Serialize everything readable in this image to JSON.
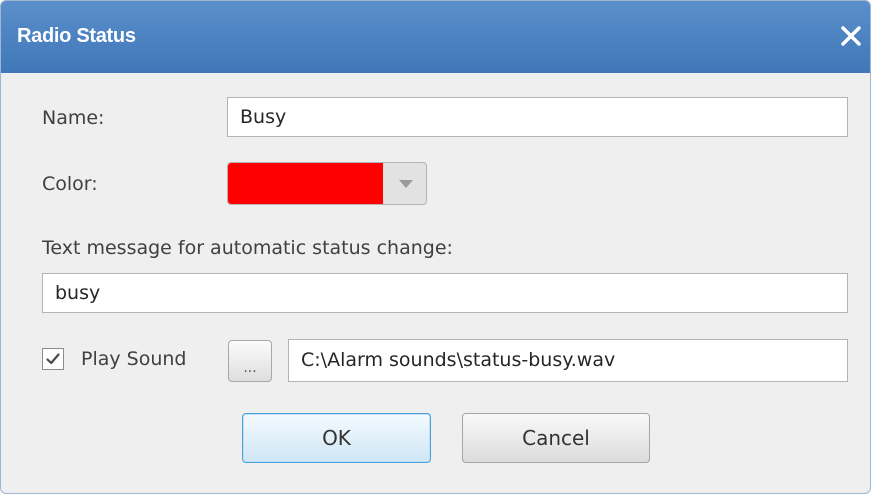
{
  "dialog": {
    "title": "Radio Status",
    "close_icon": "close-icon"
  },
  "form": {
    "name_label": "Name:",
    "name_value": "Busy",
    "color_label": "Color:",
    "color_value": "#ff0000",
    "color_dropdown_icon": "triangle-down-icon",
    "text_message_label": "Text message for automatic status change:",
    "text_message_value": "busy",
    "play_sound_checked": true,
    "play_sound_label": "Play Sound",
    "browse_label": "...",
    "sound_path": "C:\\Alarm sounds\\status-busy.wav"
  },
  "buttons": {
    "ok_label": "OK",
    "cancel_label": "Cancel"
  }
}
